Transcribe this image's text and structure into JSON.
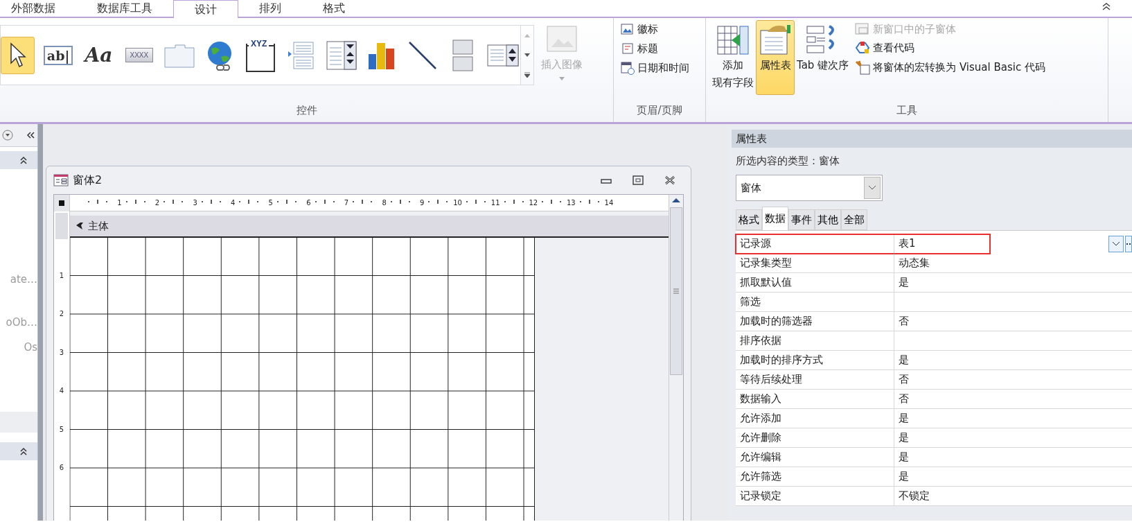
{
  "ribbon_tabs": [
    {
      "label": "外部数据",
      "selected": false
    },
    {
      "label": "数据库工具",
      "selected": false
    },
    {
      "label": "设计",
      "selected": true
    },
    {
      "label": "排列",
      "selected": false
    },
    {
      "label": "格式",
      "selected": false
    }
  ],
  "ribbon": {
    "controls_group": {
      "label": "控件",
      "tools": [
        {
          "kind": "pointer",
          "selected": true
        },
        {
          "kind": "textbox",
          "glyph": "ab|",
          "selected": false
        },
        {
          "kind": "label",
          "glyph": "Aa",
          "selected": false
        },
        {
          "kind": "button",
          "glyph": "XXXX",
          "selected": false
        },
        {
          "kind": "tab-control",
          "selected": false
        },
        {
          "kind": "hyperlink",
          "selected": false
        },
        {
          "kind": "option-group",
          "glyph": "XYZ",
          "selected": false
        },
        {
          "kind": "page-break",
          "selected": false
        },
        {
          "kind": "combo-box",
          "selected": false
        },
        {
          "kind": "chart",
          "selected": false
        },
        {
          "kind": "line",
          "selected": false
        },
        {
          "kind": "toggle-button",
          "selected": false
        },
        {
          "kind": "list-box",
          "selected": false
        }
      ],
      "insert_image": {
        "label": "插入图像",
        "disabled": true
      }
    },
    "header_footer_group": {
      "label": "页眉/页脚",
      "items": [
        {
          "kind": "logo",
          "label": "徽标"
        },
        {
          "kind": "title",
          "label": "标题"
        },
        {
          "kind": "date-time",
          "label": "日期和时间"
        }
      ]
    },
    "tools_group": {
      "label": "工具",
      "buttons": [
        {
          "kind": "add-fields",
          "lines": [
            "添加",
            "现有字段"
          ],
          "selected": false
        },
        {
          "kind": "property-sheet",
          "lines": [
            "属性表"
          ],
          "selected": true
        },
        {
          "kind": "tab-order",
          "lines": [
            "Tab 键次序"
          ],
          "selected": false
        }
      ],
      "commands": [
        {
          "kind": "subform",
          "label": "新窗口中的子窗体",
          "disabled": true
        },
        {
          "kind": "code",
          "label": "查看代码",
          "disabled": false
        },
        {
          "kind": "macro",
          "label": "将窗体的宏转换为 Visual Basic 代码",
          "disabled": false
        }
      ]
    }
  },
  "navigation_pane": {
    "items": [
      "ate…",
      "oOb…",
      "Os"
    ]
  },
  "form_window": {
    "title": "窗体2",
    "ruler_numbers": [
      "1",
      "2",
      "3",
      "4",
      "5",
      "6",
      "7",
      "8",
      "9",
      "10",
      "11",
      "12",
      "13",
      "14"
    ],
    "vertical_ruler_numbers": [
      "1",
      "2",
      "3",
      "4",
      "5",
      "6"
    ],
    "section": "主体"
  },
  "property_sheet": {
    "title": "属性表",
    "selection_type": "所选内容的类型：窗体",
    "object": "窗体",
    "tabs": [
      {
        "label": "格式",
        "selected": false
      },
      {
        "label": "数据",
        "selected": true
      },
      {
        "label": "事件",
        "selected": false
      },
      {
        "label": "其他",
        "selected": false
      },
      {
        "label": "全部",
        "selected": false
      }
    ],
    "rows": [
      {
        "name": "记录源",
        "value": "表1",
        "selected": true
      },
      {
        "name": "记录集类型",
        "value": "动态集",
        "selected": false
      },
      {
        "name": "抓取默认值",
        "value": "是",
        "selected": false
      },
      {
        "name": "筛选",
        "selected": false
      },
      {
        "name": "加载时的筛选器",
        "value": "否",
        "selected": false
      },
      {
        "name": "排序依据",
        "selected": false
      },
      {
        "name": "加载时的排序方式",
        "value": "是",
        "selected": false
      },
      {
        "name": "等待后续处理",
        "value": "否",
        "selected": false
      },
      {
        "name": "数据输入",
        "value": "否",
        "selected": false
      },
      {
        "name": "允许添加",
        "value": "是",
        "selected": false
      },
      {
        "name": "允许删除",
        "value": "是",
        "selected": false
      },
      {
        "name": "允许编辑",
        "value": "是",
        "selected": false
      },
      {
        "name": "允许筛选",
        "value": "是",
        "selected": false
      },
      {
        "name": "记录锁定",
        "value": "不锁定",
        "selected": false
      }
    ]
  }
}
